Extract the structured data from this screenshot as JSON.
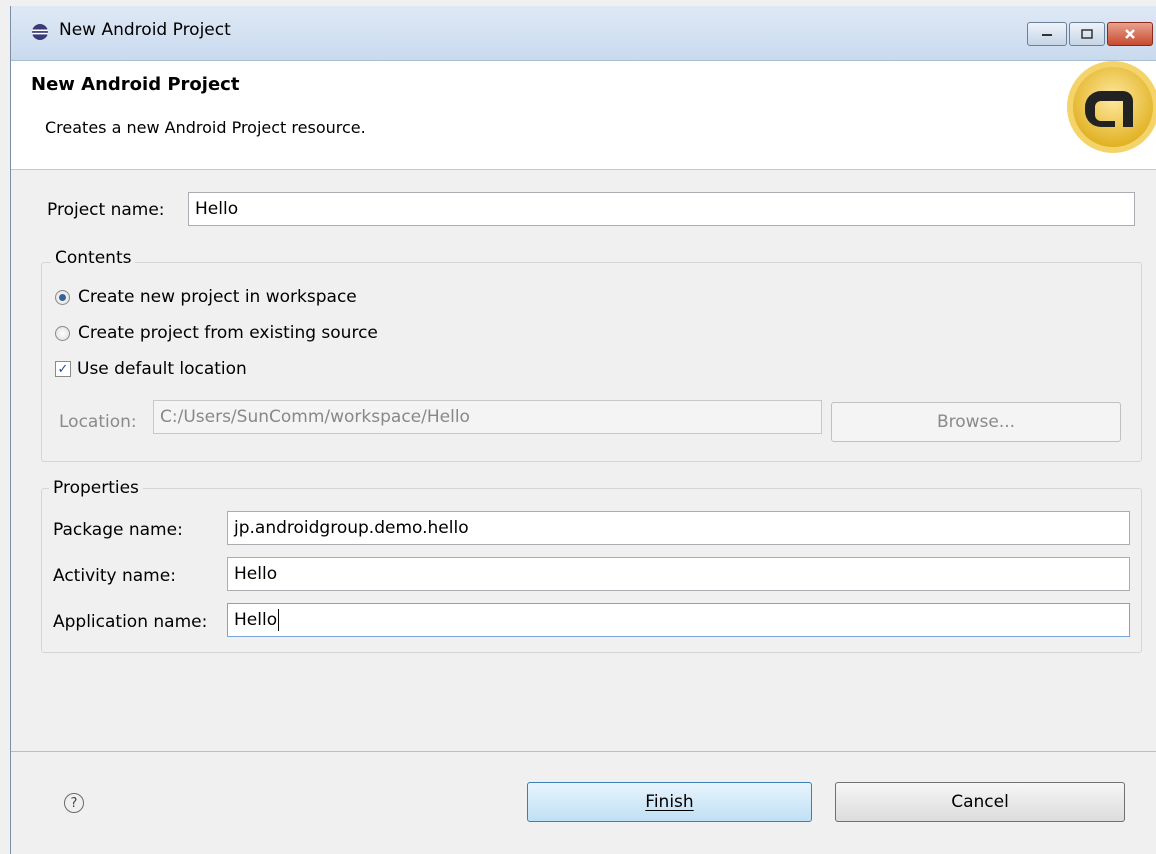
{
  "window": {
    "title": "New Android Project"
  },
  "header": {
    "title": "New Android Project",
    "description": "Creates a new Android Project resource.",
    "logo_icon": "android-adt-badge-icon"
  },
  "form": {
    "project_name_label": "Project name:",
    "project_name_value": "Hello",
    "contents": {
      "legend": "Contents",
      "option_new": "Create new project in workspace",
      "option_existing": "Create project from existing source",
      "selected": "Create new project in workspace",
      "use_default_label": "Use default location",
      "use_default_checked": true,
      "location_label": "Location:",
      "location_value": "C:/Users/SunComm/workspace/Hello",
      "browse_label": "Browse..."
    },
    "properties": {
      "legend": "Properties",
      "package_label": "Package name:",
      "package_value": "jp.androidgroup.demo.hello",
      "activity_label": "Activity name:",
      "activity_value": "Hello",
      "application_label": "Application name:",
      "application_value": "Hello"
    }
  },
  "footer": {
    "help_icon": "help-icon",
    "finish_label": "Finish",
    "cancel_label": "Cancel"
  },
  "colors": {
    "titlebar": "#c9daee",
    "default_button": "#bfe0f5",
    "close_button": "#c74a2f"
  }
}
